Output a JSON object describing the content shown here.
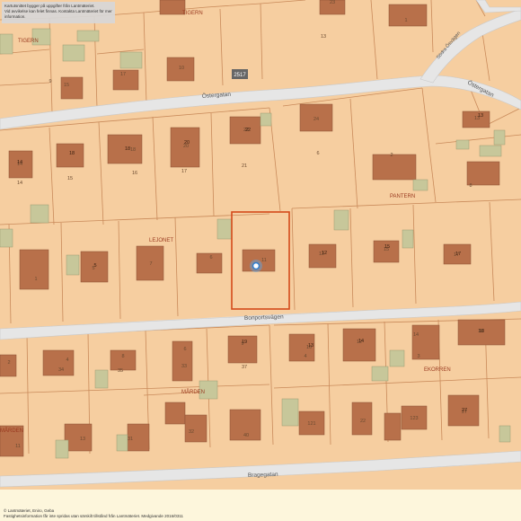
{
  "notice": {
    "line1": "Kartutsnittet bygger på uppgifter från Lantmäteriet.",
    "line2": "Vid avvikelse kan felet finnas. Kontakta Lantmäteriet för mer information."
  },
  "footer": {
    "line1": "© Lantmäteriet, Eniro, Geba",
    "line2": "Fastighetsinformation får inte spridas utan särskilt tillstånd från Lantmäteriet. Medgivande 2016/0311"
  },
  "colors": {
    "land": "#f6cea0",
    "parcel_line": "#c98a5a",
    "road": "#e6e6e6",
    "building": "#b8704a",
    "outbuilding": "#c7c79a",
    "highlight": "#d44a1a",
    "marker": "#5aa8e8"
  },
  "roads": [
    {
      "name": "Östergatan"
    },
    {
      "name": "Östergatan"
    },
    {
      "name": "Bonportsvägen"
    },
    {
      "name": "Bragegatan"
    },
    {
      "name": "Södra Ösvägen"
    }
  ],
  "blocks": [
    "TIGERN",
    "TIGERN",
    "LEJONET",
    "PANTERN",
    "MÅRDEN",
    "MÅRDEN",
    "EKORREN"
  ],
  "road_marker": "2517",
  "parcel_numbers": [
    "23",
    "1",
    "13",
    "9",
    "17",
    "15",
    "10",
    "24",
    "13",
    "14",
    "18",
    "20",
    "22",
    "6",
    "2",
    "14",
    "15",
    "16",
    "17",
    "21",
    "8",
    "1",
    "5",
    "7",
    "6",
    "11",
    "12",
    "15",
    "17",
    "4",
    "8",
    "6",
    "9",
    "10",
    "12",
    "14",
    "16",
    "18",
    "2",
    "34",
    "35",
    "33",
    "37",
    "3",
    "11",
    "13",
    "31",
    "32",
    "40",
    "12",
    "121",
    "22",
    "123",
    "27",
    "9",
    "28",
    "4",
    "4",
    "5",
    "9"
  ],
  "building_numbers": [
    "9",
    "18",
    "20",
    "22",
    "16",
    "13",
    "10",
    "14",
    "15",
    "8",
    "12",
    "7",
    "6",
    "15",
    "12",
    "17",
    "14",
    "18",
    "13",
    "19",
    "27",
    "5"
  ],
  "selected_property": {
    "number": "11"
  }
}
